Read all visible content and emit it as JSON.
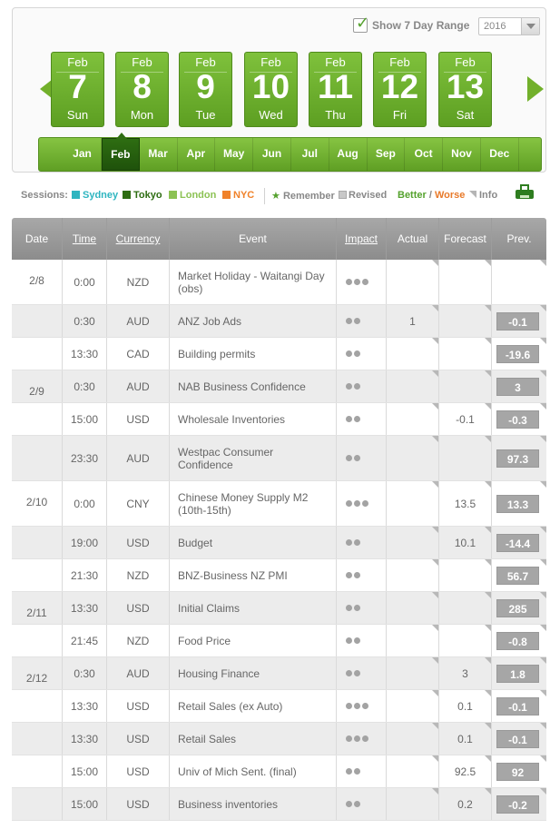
{
  "range": {
    "label": "Show 7 Day Range",
    "checked": true,
    "year": "2016"
  },
  "days": [
    {
      "month": "Feb",
      "day": "7",
      "weekday": "Sun"
    },
    {
      "month": "Feb",
      "day": "8",
      "weekday": "Mon"
    },
    {
      "month": "Feb",
      "day": "9",
      "weekday": "Tue"
    },
    {
      "month": "Feb",
      "day": "10",
      "weekday": "Wed"
    },
    {
      "month": "Feb",
      "day": "11",
      "weekday": "Thu"
    },
    {
      "month": "Feb",
      "day": "12",
      "weekday": "Fri"
    },
    {
      "month": "Feb",
      "day": "13",
      "weekday": "Sat"
    }
  ],
  "months": [
    "Jan",
    "Feb",
    "Mar",
    "Apr",
    "May",
    "Jun",
    "Jul",
    "Aug",
    "Sep",
    "Oct",
    "Nov",
    "Dec"
  ],
  "active_month": "Feb",
  "legend": {
    "sessions_label": "Sessions:",
    "sessions": [
      {
        "name": "Sydney",
        "color": "#2eb5c0"
      },
      {
        "name": "Tokyo",
        "color": "#2e6d12"
      },
      {
        "name": "London",
        "color": "#8cc254"
      },
      {
        "name": "NYC",
        "color": "#f0822a"
      }
    ],
    "remember": "Remember",
    "revised": "Revised",
    "better": "Better",
    "slash": " / ",
    "worse": "Worse",
    "info": "Info",
    "better_color": "#55a22e",
    "worse_color": "#e87a2a"
  },
  "headers": {
    "date": "Date",
    "time": "Time",
    "currency": "Currency",
    "event": "Event",
    "impact": "Impact",
    "actual": "Actual",
    "forecast": "Forecast",
    "prev": "Prev."
  },
  "rows": [
    {
      "date": "2/8",
      "time": "0:00",
      "currency": "NZD",
      "event": "Market Holiday - Waitangi Day (obs)",
      "impact": 3,
      "actual": "",
      "forecast": "",
      "prev": ""
    },
    {
      "date": "",
      "time": "0:30",
      "currency": "AUD",
      "event": "ANZ Job Ads",
      "impact": 2,
      "actual": "1",
      "forecast": "",
      "prev": "-0.1"
    },
    {
      "date": "",
      "time": "13:30",
      "currency": "CAD",
      "event": "Building permits",
      "impact": 2,
      "actual": "",
      "forecast": "",
      "prev": "-19.6"
    },
    {
      "date": "2/9",
      "time": "0:30",
      "currency": "AUD",
      "event": "NAB Business Confidence",
      "impact": 2,
      "actual": "",
      "forecast": "",
      "prev": "3"
    },
    {
      "date": "",
      "time": "15:00",
      "currency": "USD",
      "event": "Wholesale Inventories",
      "impact": 2,
      "actual": "",
      "forecast": "-0.1",
      "prev": "-0.3"
    },
    {
      "date": "",
      "time": "23:30",
      "currency": "AUD",
      "event": "Westpac Consumer Confidence",
      "impact": 2,
      "actual": "",
      "forecast": "",
      "prev": "97.3"
    },
    {
      "date": "2/10",
      "time": "0:00",
      "currency": "CNY",
      "event": "Chinese Money Supply M2 (10th-15th)",
      "impact": 3,
      "actual": "",
      "forecast": "13.5",
      "prev": "13.3"
    },
    {
      "date": "",
      "time": "19:00",
      "currency": "USD",
      "event": "Budget",
      "impact": 2,
      "actual": "",
      "forecast": "10.1",
      "prev": "-14.4"
    },
    {
      "date": "",
      "time": "21:30",
      "currency": "NZD",
      "event": "BNZ-Business NZ PMI",
      "impact": 2,
      "actual": "",
      "forecast": "",
      "prev": "56.7"
    },
    {
      "date": "2/11",
      "time": "13:30",
      "currency": "USD",
      "event": "Initial Claims",
      "impact": 2,
      "actual": "",
      "forecast": "",
      "prev": "285"
    },
    {
      "date": "",
      "time": "21:45",
      "currency": "NZD",
      "event": "Food Price",
      "impact": 2,
      "actual": "",
      "forecast": "",
      "prev": "-0.8"
    },
    {
      "date": "2/12",
      "time": "0:30",
      "currency": "AUD",
      "event": "Housing Finance",
      "impact": 2,
      "actual": "",
      "forecast": "3",
      "prev": "1.8"
    },
    {
      "date": "",
      "time": "13:30",
      "currency": "USD",
      "event": "Retail Sales (ex Auto)",
      "impact": 3,
      "actual": "",
      "forecast": "0.1",
      "prev": "-0.1"
    },
    {
      "date": "",
      "time": "13:30",
      "currency": "USD",
      "event": "Retail Sales",
      "impact": 3,
      "actual": "",
      "forecast": "0.1",
      "prev": "-0.1"
    },
    {
      "date": "",
      "time": "15:00",
      "currency": "USD",
      "event": "Univ of Mich Sent. (final)",
      "impact": 2,
      "actual": "",
      "forecast": "92.5",
      "prev": "92"
    },
    {
      "date": "",
      "time": "15:00",
      "currency": "USD",
      "event": "Business inventories",
      "impact": 2,
      "actual": "",
      "forecast": "0.2",
      "prev": "-0.2"
    }
  ]
}
